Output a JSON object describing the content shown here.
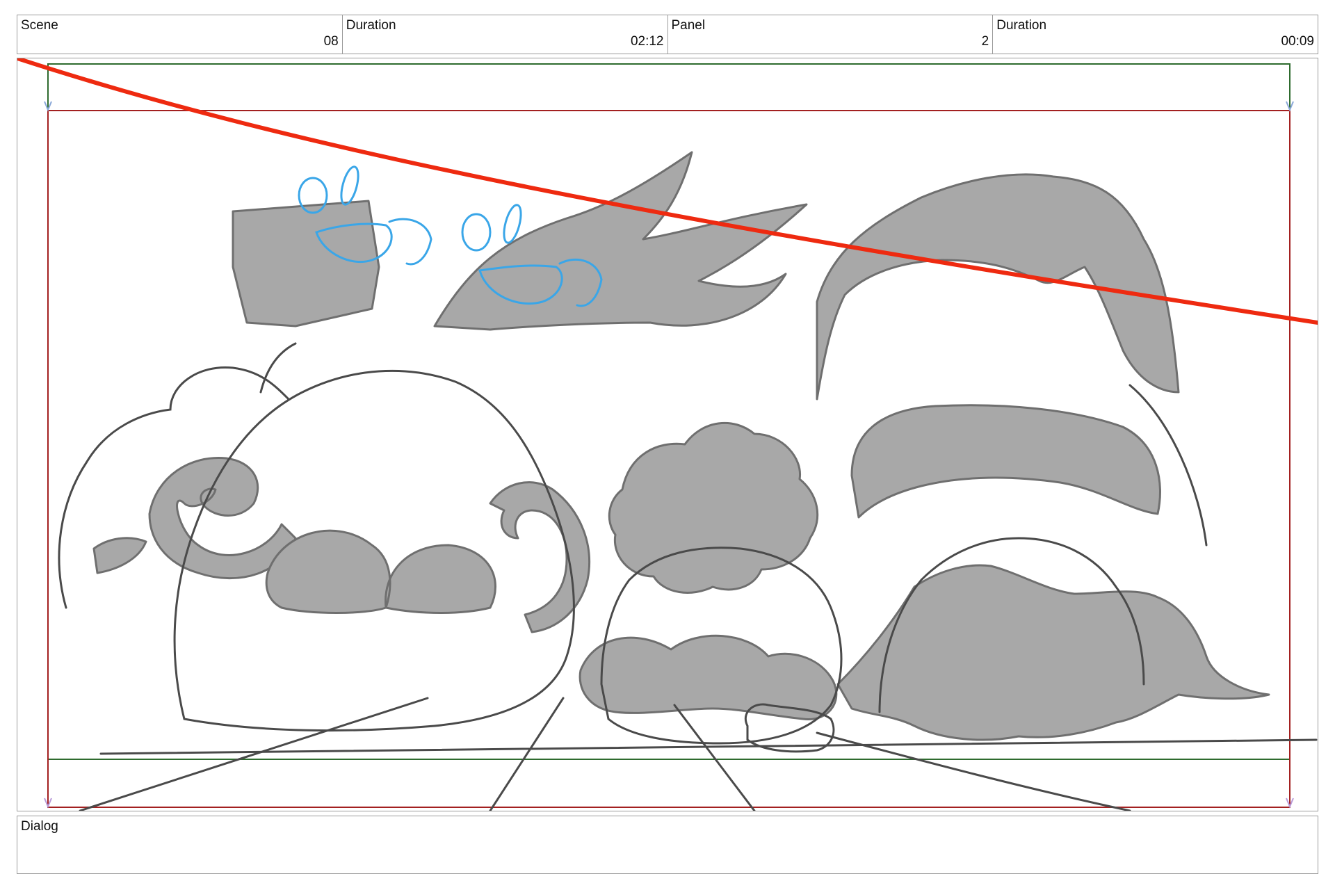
{
  "header": {
    "scene_label": "Scene",
    "scene_value": "08",
    "duration_label": "Duration",
    "duration_value": "02:12",
    "panel_label": "Panel",
    "panel_value": "2",
    "panel_duration_label": "Duration",
    "panel_duration_value": "00:09"
  },
  "frame": {
    "safe_frame_color": "#2e6b2e",
    "camera_frame_color": "#a32020",
    "annotation_line_color": "#ee2a10",
    "sketch_blue_color": "#3aa6e8",
    "sketch_gray_color": "#8c8c8c"
  },
  "dialog": {
    "label": "Dialog",
    "text": ""
  }
}
